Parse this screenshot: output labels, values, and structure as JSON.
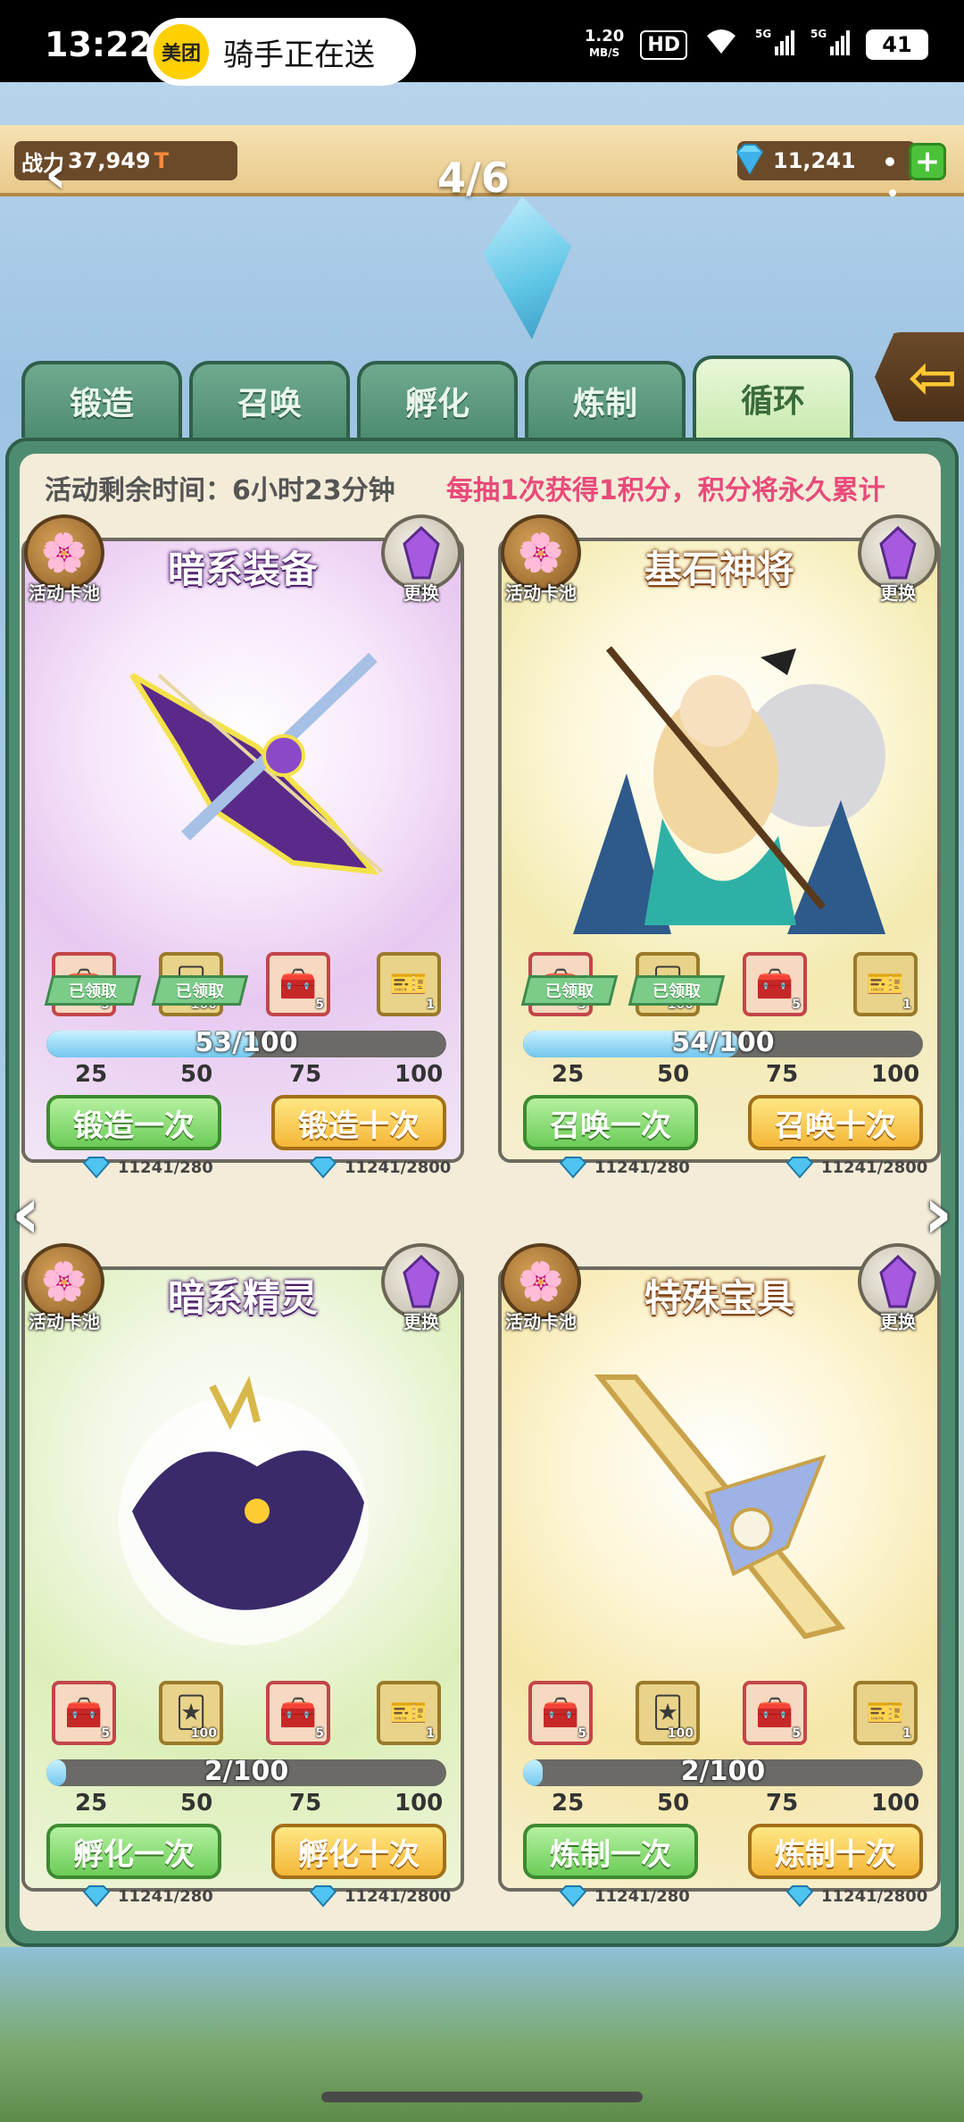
{
  "status_bar": {
    "time": "13:22",
    "app_logo": "美团",
    "notification": "骑手正在送",
    "speed_value": "1.20",
    "speed_unit": "MB/S",
    "hd": "HD",
    "battery": "41",
    "icons": [
      "wifi-icon",
      "signal-5g-icon",
      "signal-5g-icon",
      "battery-icon"
    ]
  },
  "hud": {
    "power_label": "战力",
    "power_value": "37,949",
    "power_suffix": "T",
    "page": "4/6",
    "gems": "11,241",
    "add": "+"
  },
  "tabs": [
    {
      "label": "锻造",
      "active": false
    },
    {
      "label": "召唤",
      "active": false
    },
    {
      "label": "孵化",
      "active": false
    },
    {
      "label": "炼制",
      "active": false
    },
    {
      "label": "循环",
      "active": true
    }
  ],
  "notice": {
    "time_left": "活动剩余时间：6小时23分钟",
    "rule": "每抽1次获得1积分，积分将永久累计"
  },
  "common": {
    "pool_label": "活动卡池",
    "swap_label": "更换",
    "claimed_label": "已领取",
    "milestones": [
      "25",
      "50",
      "75",
      "100"
    ]
  },
  "cards": [
    {
      "title": "暗系装备",
      "art": "bat-crossbow-art",
      "rewards": [
        "5",
        "100",
        "5",
        "1"
      ],
      "claimed": [
        true,
        true,
        false,
        false
      ],
      "progress_text": "53/100",
      "progress": 0.53,
      "btn_one": "锻造一次",
      "btn_ten": "锻造十次",
      "cost_one": "11241/280",
      "cost_ten": "11241/2800"
    },
    {
      "title": "基石神将",
      "art": "warrior-girl-art",
      "rewards": [
        "5",
        "100",
        "5",
        "1"
      ],
      "claimed": [
        true,
        true,
        false,
        false
      ],
      "progress_text": "54/100",
      "progress": 0.54,
      "btn_one": "召唤一次",
      "btn_ten": "召唤十次",
      "cost_one": "11241/280",
      "cost_ten": "11241/2800"
    },
    {
      "title": "暗系精灵",
      "art": "dark-dragon-art",
      "rewards": [
        "5",
        "100",
        "5",
        "1"
      ],
      "claimed": [
        false,
        false,
        false,
        false
      ],
      "progress_text": "2/100",
      "progress": 0.02,
      "btn_one": "孵化一次",
      "btn_ten": "孵化十次",
      "cost_one": "11241/280",
      "cost_ten": "11241/2800"
    },
    {
      "title": "特殊宝具",
      "art": "golden-sword-art",
      "rewards": [
        "5",
        "100",
        "5",
        "1"
      ],
      "claimed": [
        false,
        false,
        false,
        false
      ],
      "progress_text": "2/100",
      "progress": 0.02,
      "btn_one": "炼制一次",
      "btn_ten": "炼制十次",
      "cost_one": "11241/280",
      "cost_ten": "11241/2800"
    }
  ],
  "arrows": {
    "left": "‹",
    "right": "›"
  }
}
